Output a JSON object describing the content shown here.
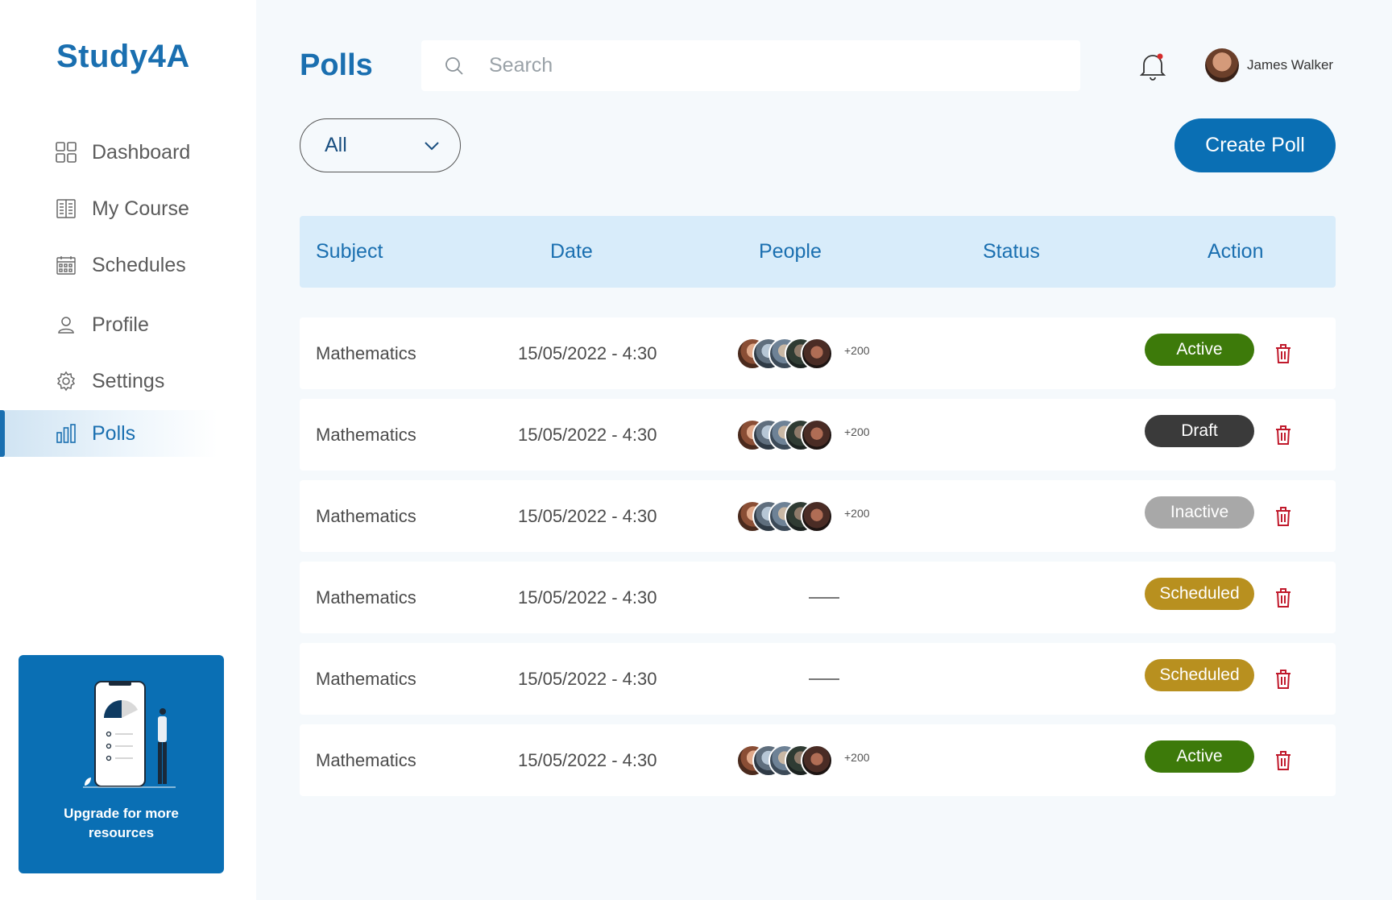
{
  "app": {
    "logo": "Study4A"
  },
  "sidebar": {
    "items": [
      {
        "label": "Dashboard",
        "icon": "grid-icon"
      },
      {
        "label": "My Course",
        "icon": "book-icon"
      },
      {
        "label": "Schedules",
        "icon": "calendar-icon"
      },
      {
        "label": "Profile",
        "icon": "user-icon"
      },
      {
        "label": "Settings",
        "icon": "gear-icon"
      },
      {
        "label": "Polls",
        "icon": "bar-chart-icon",
        "active": true
      }
    ],
    "upgrade": {
      "text_line1": "Upgrade for more",
      "text_line2": "resources"
    }
  },
  "header": {
    "title": "Polls",
    "search_placeholder": "Search",
    "user_name": "James Walker"
  },
  "toolbar": {
    "filter_value": "All",
    "create_label": "Create Poll"
  },
  "table": {
    "columns": [
      "Subject",
      "Date",
      "People",
      "Status",
      "Action"
    ],
    "rows": [
      {
        "subject": "Mathematics",
        "date": "15/05/2022 - 4:30",
        "people_more": "+200",
        "status": "Active"
      },
      {
        "subject": "Mathematics",
        "date": "15/05/2022 - 4:30",
        "people_more": "+200",
        "status": "Draft"
      },
      {
        "subject": "Mathematics",
        "date": "15/05/2022 - 4:30",
        "people_more": "+200",
        "status": "Inactive"
      },
      {
        "subject": "Mathematics",
        "date": "15/05/2022 - 4:30",
        "people_more": "",
        "status": "Scheduled"
      },
      {
        "subject": "Mathematics",
        "date": "15/05/2022 - 4:30",
        "people_more": "",
        "status": "Scheduled"
      },
      {
        "subject": "Mathematics",
        "date": "15/05/2022 - 4:30",
        "people_more": "+200",
        "status": "Active"
      }
    ]
  },
  "colors": {
    "brand": "#1a6fb0",
    "active": "#3d7a0a",
    "draft": "#3a3a3a",
    "inactive": "#a8a8a8",
    "scheduled": "#b8901f",
    "trash": "#c0192b"
  }
}
